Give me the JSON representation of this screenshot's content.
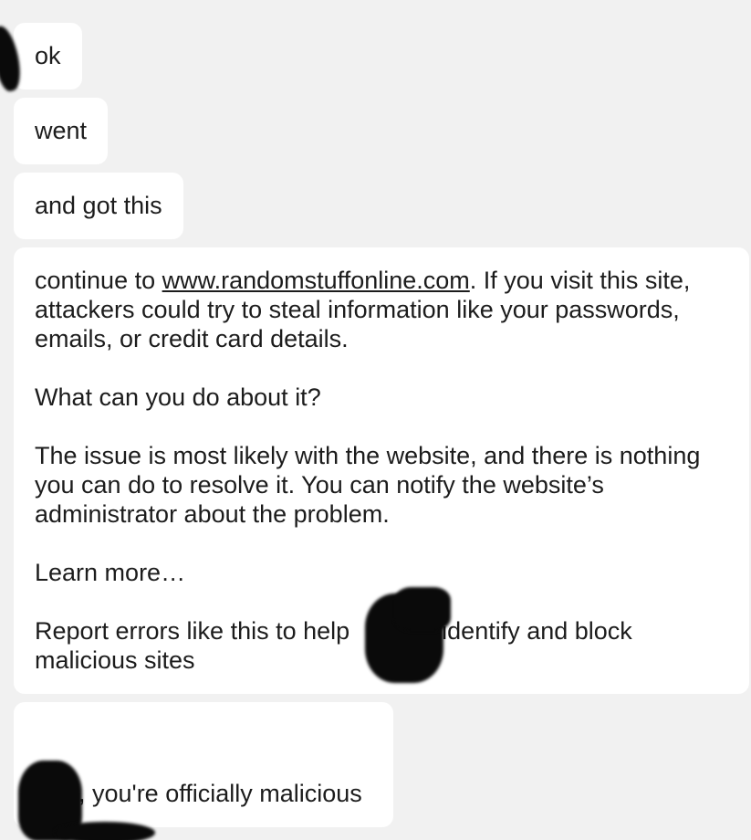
{
  "messages": [
    {
      "text": "ok"
    },
    {
      "text": "went"
    },
    {
      "text": "and got this"
    }
  ],
  "warning": {
    "intro_prefix": "continue to ",
    "site_link": "www.randomstuffonline.com",
    "intro_suffix": ". If you visit this site, attackers could try to steal information like your passwords, emails, or credit card details.",
    "question": "What can you do about it?",
    "answer": "The issue is most likely with the website, and there is nothing you can do to resolve it. You can notify the website’s administrator about the problem.",
    "learn_more": "Learn more…",
    "report_prefix": "Report errors like this to help ",
    "report_suffix": " identify and block malicious sites"
  },
  "last_message": {
    "text": ", you're officially malicious"
  }
}
